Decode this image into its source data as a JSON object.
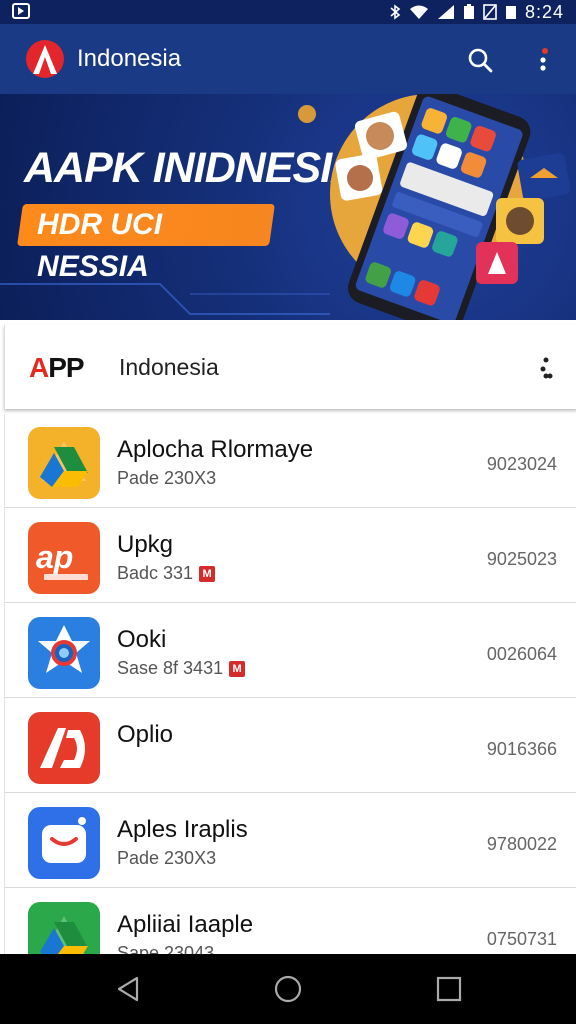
{
  "status": {
    "time": "8:24"
  },
  "appbar": {
    "title": "Indonesia"
  },
  "banner": {
    "headline": "AAPK INIDNESIA",
    "pill": "HDR UCI NESSIA"
  },
  "section": {
    "logo_a": "A",
    "logo_pp": "PP",
    "title": "Indonesia"
  },
  "apps": [
    {
      "name": "Aplocha Rlormaye",
      "sub": "Pade 230X3",
      "num": "9023024",
      "badge": "",
      "icon": "drive-triangle-icon",
      "color": "#f4b12a"
    },
    {
      "name": "Upkg",
      "sub": "Badc 331",
      "num": "9025023",
      "badge": "M",
      "icon": "ap-logo-icon",
      "color": "#f05a2a"
    },
    {
      "name": "Ooki",
      "sub": "Sase 8f 3431",
      "num": "0026064",
      "badge": "M",
      "icon": "camera-star-icon",
      "color": "#2b7fe0"
    },
    {
      "name": "Oplio",
      "sub": "",
      "num": "9016366",
      "badge": "",
      "icon": "ad-logo-icon",
      "color": "#e63a2a"
    },
    {
      "name": "Aples Iraplis",
      "sub": "Pade 230X3",
      "num": "9780022",
      "badge": "",
      "icon": "chat-face-icon",
      "color": "#2f6fe8"
    },
    {
      "name": "Apliiai Iaaple",
      "sub": "Sape 23043",
      "num": "0750731",
      "badge": "",
      "icon": "drive-triangle-icon",
      "color": "#2aa84a"
    }
  ]
}
